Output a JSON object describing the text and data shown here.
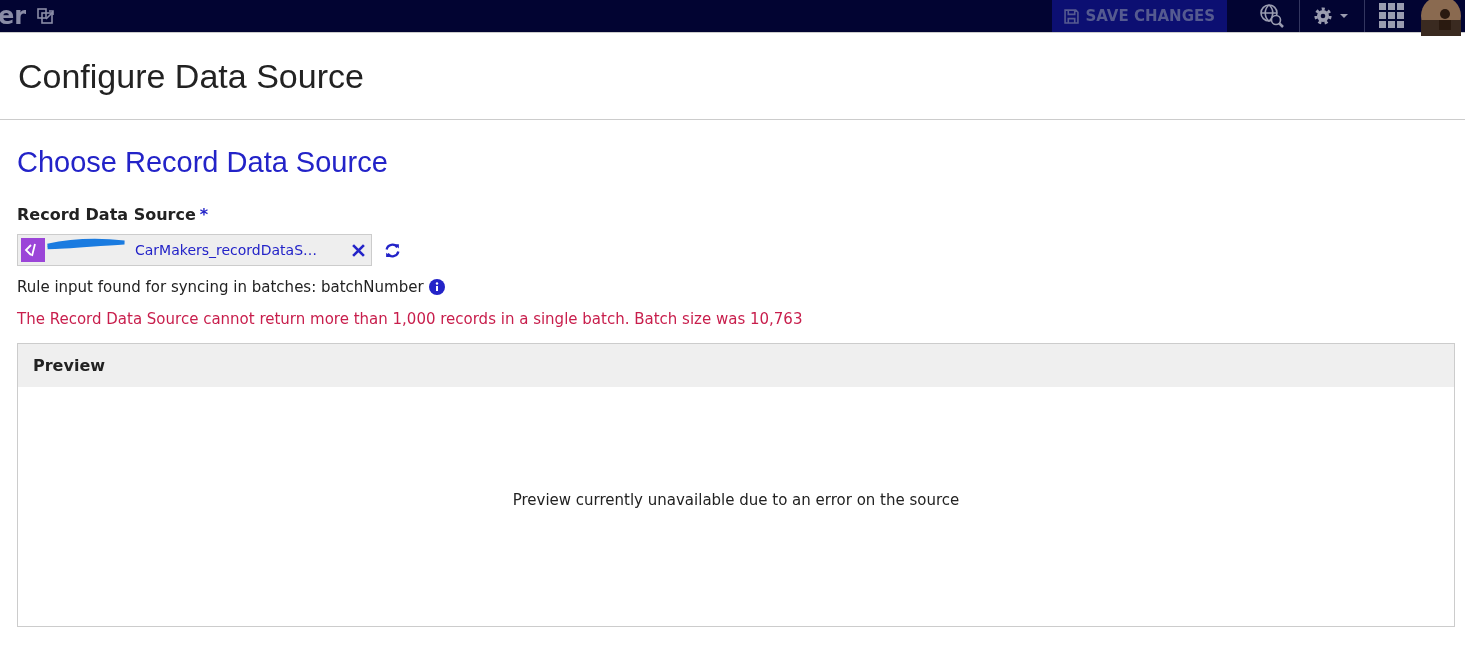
{
  "topbar": {
    "app_name": "er",
    "save_button": {
      "label": "SAVE CHANGES",
      "disabled": true
    }
  },
  "page": {
    "title": "Configure Data Source"
  },
  "section": {
    "title": "Choose Record Data Source",
    "field": {
      "label": "Record Data Source",
      "required_mark": "*",
      "value": "CarMakers_recordDataS…"
    },
    "rule_info": "Rule input found for syncing in batches: batchNumber",
    "error": "The Record Data Source cannot return more than 1,000 records in a single batch. Batch size was 10,763"
  },
  "preview": {
    "title": "Preview",
    "message": "Preview currently unavailable due to an error on the source"
  }
}
